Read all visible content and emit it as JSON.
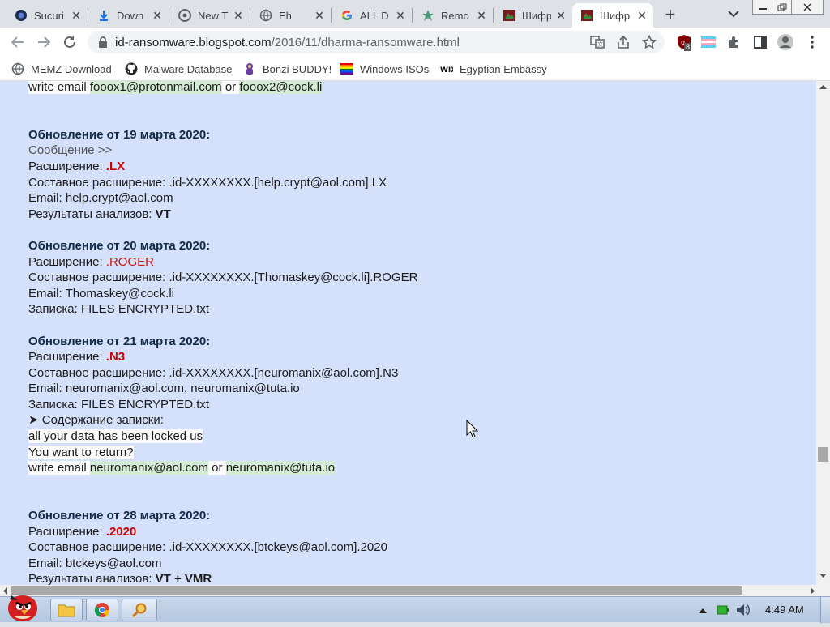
{
  "browser": {
    "tabs": [
      {
        "label": "Sucuri",
        "icon": "sucuri-icon",
        "active": false
      },
      {
        "label": "Down",
        "icon": "download-icon",
        "active": false
      },
      {
        "label": "New T",
        "icon": "chrome-icon",
        "active": false
      },
      {
        "label": "Eh",
        "icon": "globe-icon",
        "active": false
      },
      {
        "label": "ALL D",
        "icon": "google-icon",
        "active": false
      },
      {
        "label": "Remo",
        "icon": "remove-site-icon",
        "active": false
      },
      {
        "label": "Шифр",
        "icon": "blog-favicon-icon",
        "active": false
      },
      {
        "label": "Шифр",
        "icon": "blog-favicon-icon",
        "active": true
      }
    ],
    "url": {
      "host": "id-ransomware.blogspot.com",
      "path": "/2016/11/dharma-ransomware.html"
    },
    "extension_badge": "8",
    "bookmarks": [
      {
        "label": "MEMZ Download",
        "icon": "globe-icon"
      },
      {
        "label": "Malware Database",
        "icon": "github-icon"
      },
      {
        "label": "Bonzi BUDDY!",
        "icon": "bonzi-icon"
      },
      {
        "label": "Windows ISOs",
        "icon": "rainbow-flag-icon"
      },
      {
        "label": "Egyptian Embassy",
        "icon": "wix-icon"
      }
    ]
  },
  "page": {
    "top": {
      "prefix": "write email ",
      "email1": "fooox1@protonmail.com",
      "or": " or ",
      "email2": "fooox2@cock.li"
    },
    "update1": {
      "header": "Обновление от 19 марта 2020:",
      "message": "Сообщение >>",
      "ext_label": "Расширение: ",
      "ext": ".LX",
      "composite": "Составное расширение: .id-XXXXXXXX.[help.crypt@aol.com].LX",
      "email": "Email: help.crypt@aol.com",
      "results_label": "Результаты анализов: ",
      "results": "VT"
    },
    "update2": {
      "header": "Обновление от 20 марта 2020:",
      "ext_label": "Расширение: ",
      "ext": ".ROGER",
      "composite": "Составное расширение: .id-XXXXXXXX.[Thomaskey@cock.li].ROGER",
      "email": "Email: Thomaskey@cock.li",
      "note": "Записка: FILES ENCRYPTED.txt"
    },
    "update3": {
      "header": "Обновление от 21 марта 2020:",
      "ext_label": "Расширение: ",
      "ext": ".N3",
      "composite": "Составное расширение: .id-XXXXXXXX.[neuromanix@aol.com].N3",
      "email": "Email: neuromanix@aol.com, neuromanix@tuta.io",
      "note": "Записка: FILES ENCRYPTED.txt",
      "content_label": "➤ Содержание записки:",
      "note_line1": "all your data has been locked us",
      "note_line2": "You want to return?",
      "note_line3_prefix": "write email ",
      "note_email1": "neuromanix@aol.com",
      "note_or": " or ",
      "note_email2": "neuromanix@tuta.io"
    },
    "update4": {
      "header": "Обновление от 28 марта 2020:",
      "ext_label": "Расширение: ",
      "ext": ".2020",
      "composite": "Составное расширение: .id-XXXXXXXX.[btckeys@aol.com].2020",
      "email": "Email: btckeys@aol.com",
      "results_label": "Результаты анализов: ",
      "results": "VT + VMR"
    }
  },
  "taskbar": {
    "clock": "4:49 AM"
  },
  "colors": {
    "page_bg": "#d5e1fb",
    "header_text": "#122b48",
    "extension_red": "#cc0000",
    "email_highlight": "#d5ecd4"
  }
}
